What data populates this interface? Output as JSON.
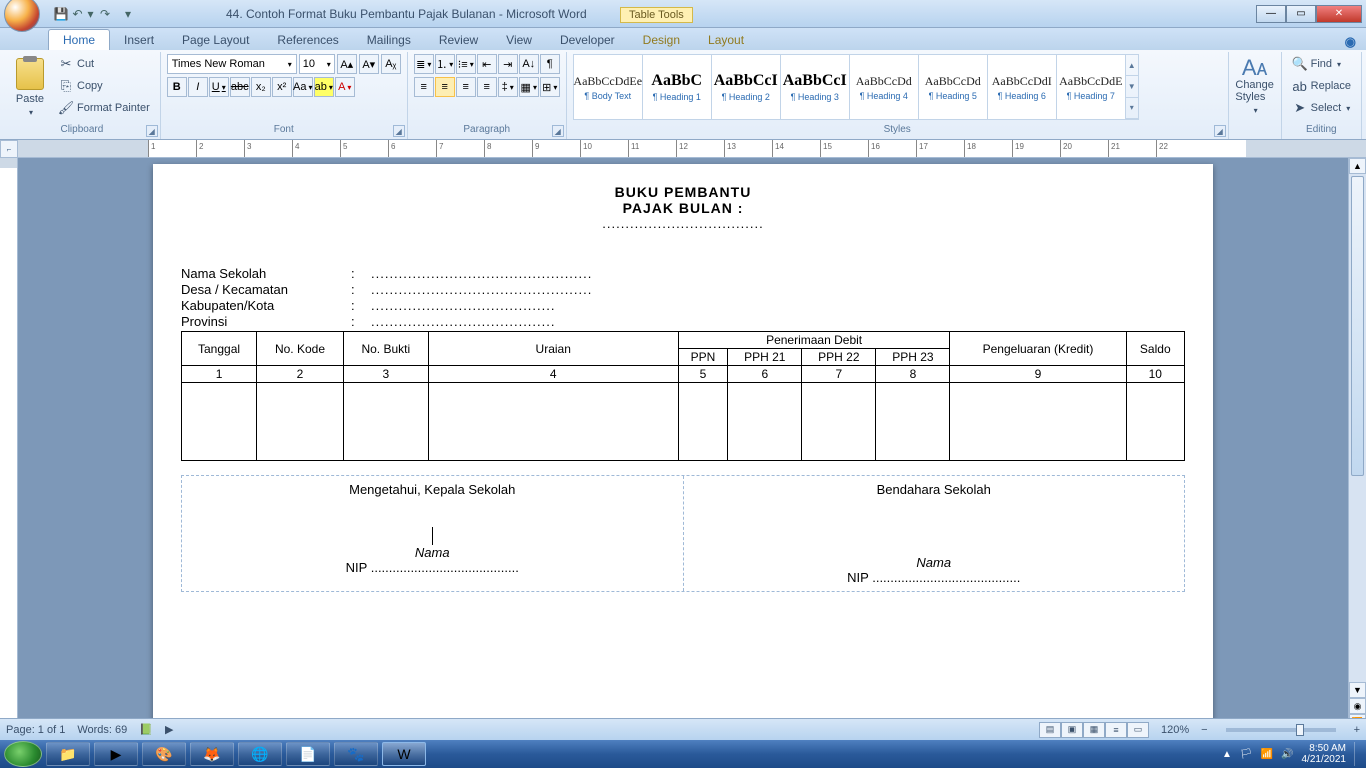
{
  "window": {
    "title": "44. Contoh Format Buku Pembantu Pajak Bulanan - Microsoft Word",
    "context_tab": "Table Tools"
  },
  "tabs": {
    "home": "Home",
    "insert": "Insert",
    "pagelayout": "Page Layout",
    "references": "References",
    "mailings": "Mailings",
    "review": "Review",
    "view": "View",
    "developer": "Developer",
    "design": "Design",
    "layout": "Layout"
  },
  "clipboard": {
    "paste": "Paste",
    "cut": "Cut",
    "copy": "Copy",
    "format_painter": "Format Painter",
    "label": "Clipboard"
  },
  "font": {
    "name": "Times New Roman",
    "size": "10",
    "label": "Font"
  },
  "paragraph": {
    "label": "Paragraph"
  },
  "styles": {
    "label": "Styles",
    "items": [
      {
        "preview": "AaBbCcDdEe",
        "name": "¶ Body Text",
        "cls": ""
      },
      {
        "preview": "AaBbC",
        "name": "¶ Heading 1",
        "cls": "big"
      },
      {
        "preview": "AaBbCcI",
        "name": "¶ Heading 2",
        "cls": "big"
      },
      {
        "preview": "AaBbCcI",
        "name": "¶ Heading 3",
        "cls": "big"
      },
      {
        "preview": "AaBbCcDd",
        "name": "¶ Heading 4",
        "cls": ""
      },
      {
        "preview": "AaBbCcDd",
        "name": "¶ Heading 5",
        "cls": ""
      },
      {
        "preview": "AaBbCcDdI",
        "name": "¶ Heading 6",
        "cls": ""
      },
      {
        "preview": "AaBbCcDdE",
        "name": "¶ Heading 7",
        "cls": ""
      }
    ],
    "change": "Change Styles"
  },
  "editing": {
    "find": "Find",
    "replace": "Replace",
    "select": "Select",
    "label": "Editing"
  },
  "document": {
    "title1": "BUKU PEMBANTU",
    "title2": "PAJAK BULAN  :",
    "dots": "...................................",
    "info": [
      {
        "lbl": "Nama Sekolah",
        "val": "................................................"
      },
      {
        "lbl": "Desa / Kecamatan",
        "val": "................................................"
      },
      {
        "lbl": "Kabupaten/Kota",
        "val": "........................................"
      },
      {
        "lbl": "Provinsi",
        "val": "........................................"
      }
    ],
    "thead": {
      "tanggal": "Tanggal",
      "kode": "No. Kode",
      "bukti": "No. Bukti",
      "uraian": "Uraian",
      "debit": "Penerimaan  Debit",
      "ppn": "PPN",
      "pph21": "PPH 21",
      "pph22": "PPH 22",
      "pph23": "PPH 23",
      "kredit": "Pengeluaran (Kredit)",
      "saldo": "Saldo"
    },
    "nums": [
      "1",
      "2",
      "3",
      "4",
      "5",
      "6",
      "7",
      "8",
      "9",
      "10"
    ],
    "sig": {
      "left_title": "Mengetahui,   Kepala  Sekolah",
      "right_title": "Bendahara  Sekolah",
      "nama": "Nama",
      "nip": "NIP ........................................."
    }
  },
  "status": {
    "page": "Page: 1 of 1",
    "words": "Words: 69",
    "zoom": "120%"
  },
  "taskbar": {
    "time": "8:50 AM",
    "date": "4/21/2021"
  }
}
